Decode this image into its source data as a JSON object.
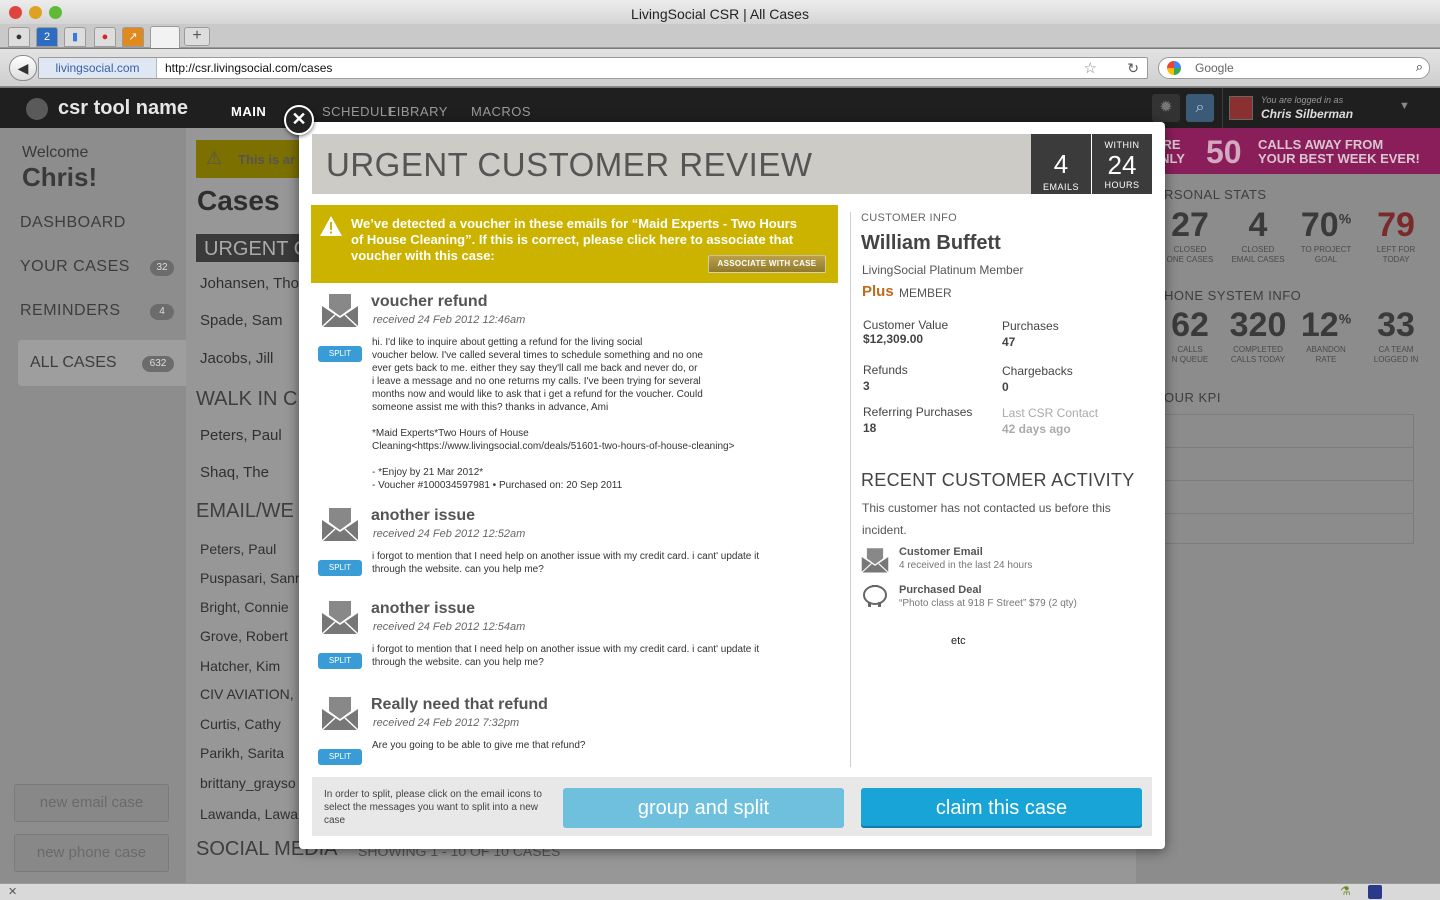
{
  "browser": {
    "window_title": "LivingSocial CSR | All Cases",
    "url_site": "livingsocial.com",
    "url": "http://csr.livingsocial.com/cases",
    "search_placeholder": "Google",
    "tab_badge": "2"
  },
  "app": {
    "name": "csr tool name",
    "nav": [
      "MAIN",
      "SCHEDULE",
      "LIBRARY",
      "MACROS"
    ],
    "logged_in_label": "You are logged in as",
    "logged_in_name": "Chris Silberman"
  },
  "sidebar": {
    "welcome": "Welcome",
    "user": "Chris!",
    "items": [
      {
        "label": "DASHBOARD",
        "count": ""
      },
      {
        "label": "YOUR CASES",
        "count": "32"
      },
      {
        "label": "REMINDERS",
        "count": "4"
      },
      {
        "label": "ALL CASES",
        "count": "632"
      }
    ],
    "new_email_case": "new email case",
    "new_phone_case": "new phone case"
  },
  "main": {
    "warning": "This is ar",
    "cases_title": "Cases",
    "urgent": "URGENT C",
    "urgent_cases": [
      "Johansen, Tho",
      "Spade, Sam",
      "Jacobs, Jill"
    ],
    "walkin": "WALK IN C",
    "walkin_cases": [
      "Peters, Paul",
      "Shaq, The"
    ],
    "email": "EMAIL/WE",
    "email_cases": [
      "Peters, Paul",
      "Puspasari, Sanr",
      "Bright, Connie",
      "Grove, Robert",
      "Hatcher, Kim",
      "CIV AVIATION,",
      "Curtis, Cathy",
      "Parikh, Sarita",
      "brittany_grayso",
      "Lawanda, Lawa"
    ],
    "social": "SOCIAL MEDIA",
    "social_showing": "SHOWING 1 - 10 OF 10 CASES"
  },
  "rightpanel": {
    "promo_left_1": "U'RE",
    "promo_left_2": "ONLY",
    "promo_num": "50",
    "promo_right_1": "CALLS AWAY FROM",
    "promo_right_2": "YOUR BEST WEEK EVER!",
    "personal_stats": "RSONAL STATS",
    "stats": [
      {
        "value": "27",
        "label1": "CLOSED",
        "label2": "ONE CASES"
      },
      {
        "value": "4",
        "label1": "CLOSED",
        "label2": "EMAIL CASES"
      },
      {
        "value": "70",
        "sup": "%",
        "label1": "TO PROJECT",
        "label2": "GOAL"
      },
      {
        "value": "79",
        "label1": "LEFT FOR",
        "label2": "TODAY"
      }
    ],
    "phone_system": "HONE SYSTEM INFO",
    "phone_stats": [
      {
        "value": "62",
        "label1": "CALLS",
        "label2": "N QUEUE"
      },
      {
        "value": "320",
        "label1": "COMPLETED",
        "label2": "CALLS TODAY"
      },
      {
        "value": "12",
        "sup": "%",
        "label1": "ABANDON",
        "label2": "RATE"
      },
      {
        "value": "33",
        "label1": "CA TEAM",
        "label2": "LOGGED IN"
      }
    ],
    "kpi": "OUR KPI",
    "accent_red": "#a83232"
  },
  "modal": {
    "title": "URGENT CUSTOMER REVIEW",
    "emails_count": "4",
    "emails_label": "EMAILS",
    "within_label": "WITHIN",
    "hours_count": "24",
    "hours_label": "HOURS",
    "alert_text": "We’ve detected a voucher in these emails for “Maid Experts - Two Hours of House Cleaning”. If this is correct, please click here to associate that voucher with this case:",
    "associate_label": "ASSOCIATE WITH CASE",
    "split_label": "SPLIT",
    "messages": [
      {
        "subject": "voucher refund",
        "date": "received 24 Feb 2012 12:46am",
        "body": "hi. I'd like to inquire about getting a refund for the living social\nvoucher below. I've called several times to schedule something and no one\never gets back to me. either they say they'll call me back and never do, or\ni leave a message and no one returns my calls. I've been trying for several\nmonths now and would like to ask that i get a refund for the voucher. Could\nsomeone assist me with this? thanks in advance, Ami\n\n*Maid Experts*Two Hours of House\nCleaning<https://www.livingsocial.com/deals/51601-two-hours-of-house-cleaning>\n\n- *Enjoy by 21 Mar 2012*\n- Voucher #100034597981 • Purchased on: 20 Sep 2011"
      },
      {
        "subject": "another issue",
        "date": "received 24 Feb 2012 12:52am",
        "body": "i forgot to mention that I need help on another issue with my credit card. i cant' update it\nthrough the website. can you help me?"
      },
      {
        "subject": "another issue",
        "date": "received 24 Feb 2012 12:54am",
        "body": "i forgot to mention that I need help on another issue with my credit card. i cant' update it\nthrough the website. can you help me?"
      },
      {
        "subject": "Really need that refund",
        "date": "received 24 Feb 2012 7:32pm",
        "body": "Are you going to be able to give me that refund?"
      }
    ],
    "customer": {
      "section_label": "CUSTOMER INFO",
      "name": "William Buffett",
      "tier": "LivingSocial Platinum Member",
      "plus": "Plus",
      "member": "MEMBER",
      "stats": [
        {
          "label": "Customer Value",
          "value": "$12,309.00"
        },
        {
          "label": "Purchases",
          "value": "47"
        },
        {
          "label": "Refunds",
          "value": "3"
        },
        {
          "label": "Chargebacks",
          "value": "0"
        },
        {
          "label": "Referring Purchases",
          "value": "18"
        },
        {
          "label": "Last CSR Contact",
          "value": "42 days ago"
        }
      ]
    },
    "recent": {
      "title": "RECENT CUSTOMER ACTIVITY",
      "text": "This customer has not contacted us before this incident.",
      "activities": [
        {
          "title": "Customer Email",
          "sub": "4 received in the last 24 hours"
        },
        {
          "title": "Purchased Deal",
          "sub": "“Photo class at 918 F Street” $79 (2 qty)"
        }
      ],
      "etc": "etc"
    },
    "footer_text": "In order to split, please click on the email icons to select the messages you want to split into a new case",
    "group_split": "group and split",
    "claim": "claim this case"
  }
}
